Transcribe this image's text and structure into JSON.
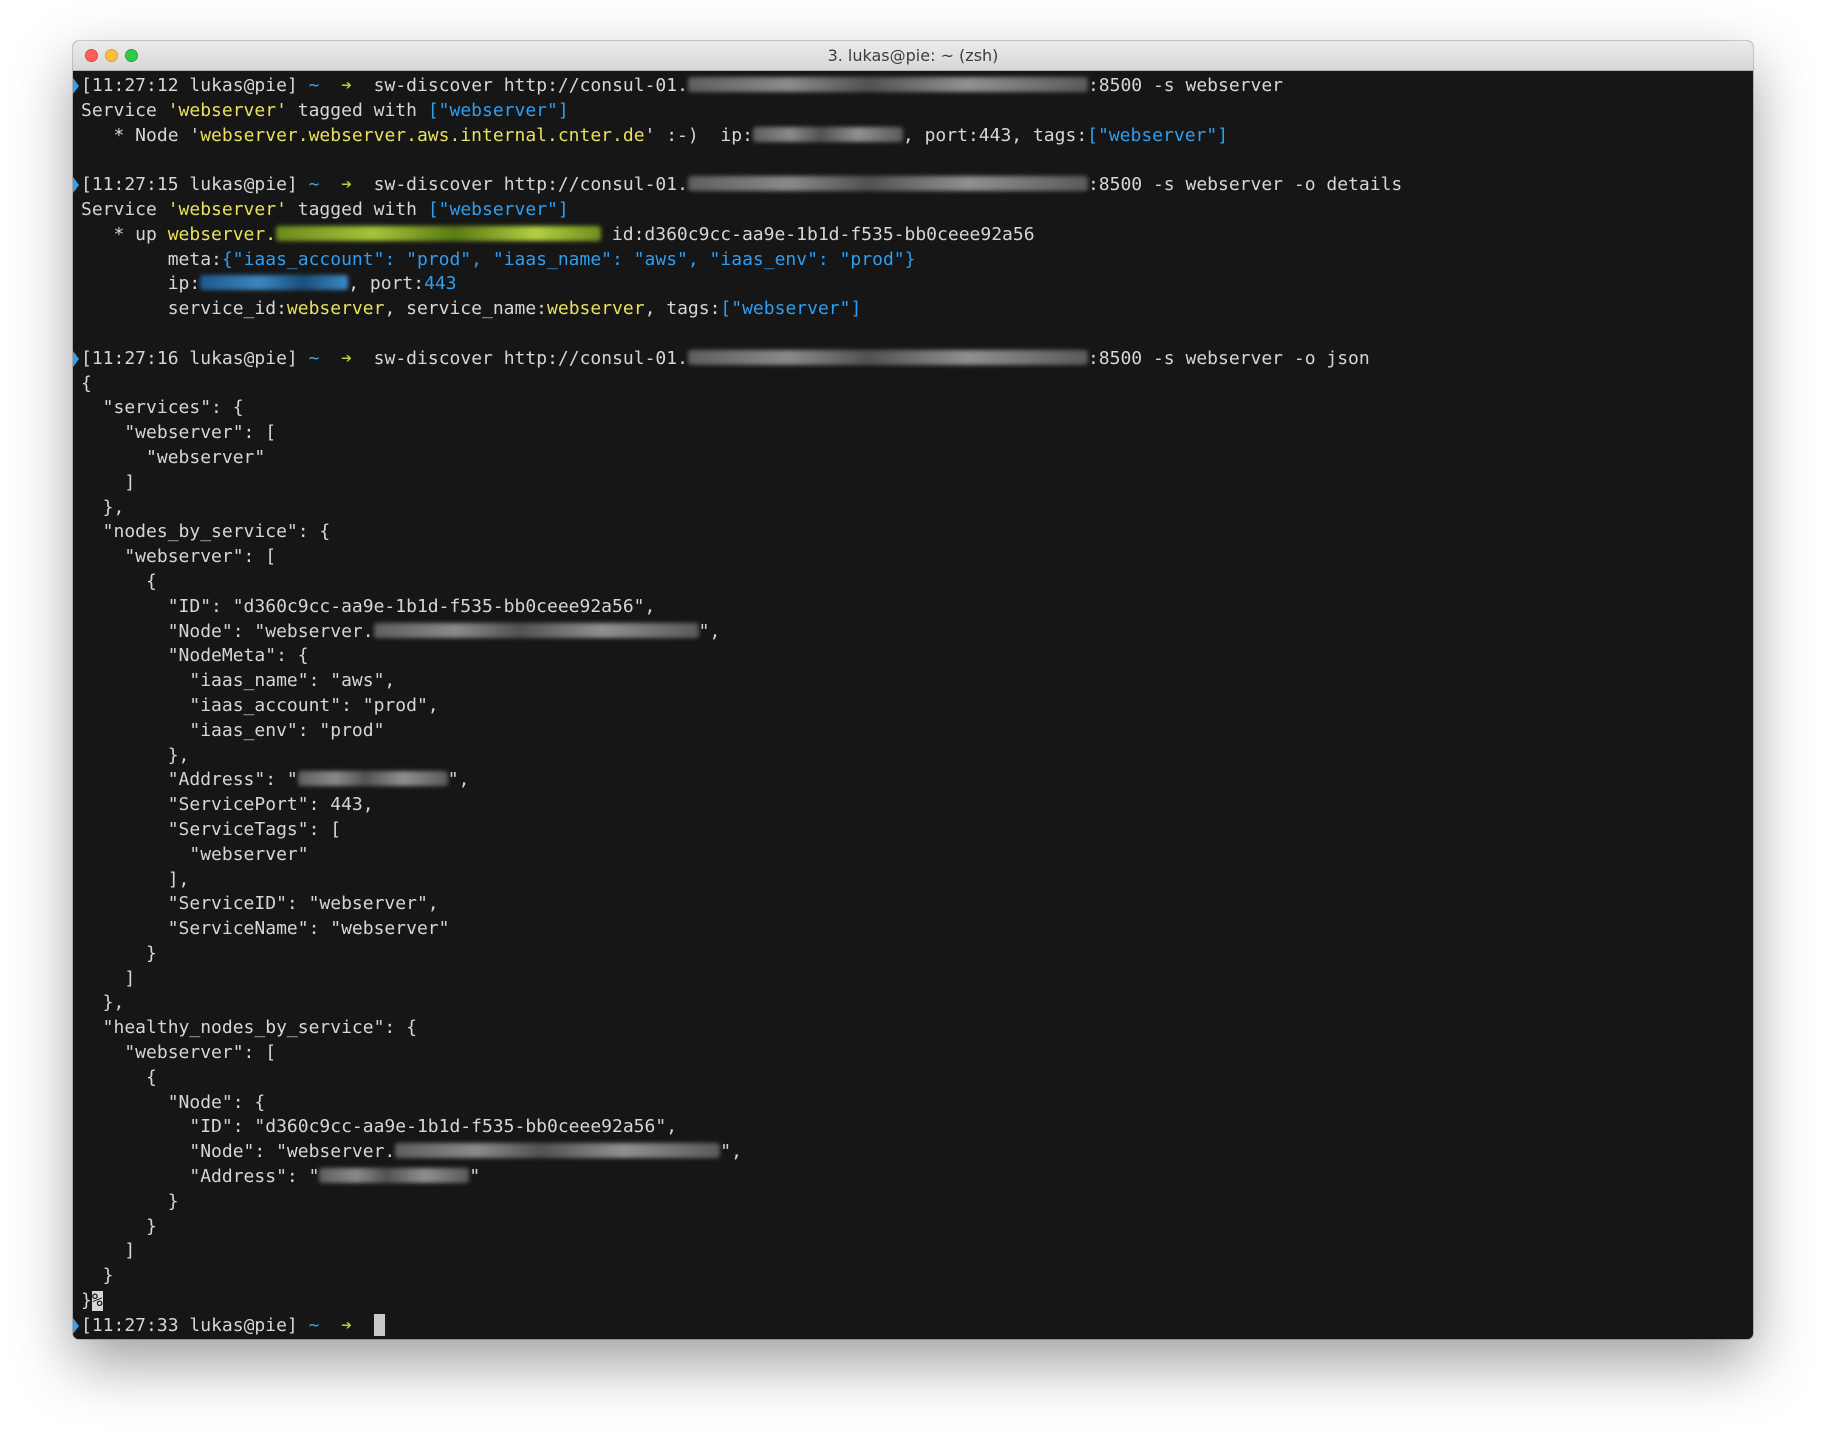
{
  "window": {
    "title": "3. lukas@pie: ~ (zsh)"
  },
  "prompt": {
    "user_host": "lukas@pie]",
    "tilde": "~",
    "arrow": "➔"
  },
  "commands": [
    {
      "time": "[11:27:12",
      "base": "sw-discover http://consul-01.",
      "suffix": ":8500 -s webserver"
    },
    {
      "time": "[11:27:15",
      "base": "sw-discover http://consul-01.",
      "suffix": ":8500 -s webserver -o details"
    },
    {
      "time": "[11:27:16",
      "base": "sw-discover http://consul-01.",
      "suffix": ":8500 -s webserver -o json"
    },
    {
      "time": "[11:27:33"
    }
  ],
  "out1": {
    "service_kw": "Service ",
    "service_name": "'webserver'",
    "tagged": " tagged with ",
    "tags": "[\"webserver\"]",
    "node_prefix": "   * Node '",
    "node_name": "webserver.webserver.aws.internal.cnter.de",
    "node_suffix": "' :-)  ip:",
    "port": ", port:443, tags:",
    "node_tags": "[\"webserver\"]"
  },
  "out2": {
    "up_prefix": "   * up ",
    "host": "webserver.",
    "id": " id:d360c9cc-aa9e-1b1d-f535-bb0ceee92a56",
    "meta_label": "        meta:",
    "meta_value": "{\"iaas_account\": \"prod\", \"iaas_name\": \"aws\", \"iaas_env\": \"prod\"}",
    "ip_label": "        ip:",
    "port_label": ", port:",
    "port_value": "443",
    "sid_label": "        service_id:",
    "sid_value": "webserver",
    "sname_label": ", service_name:",
    "sname_value": "webserver",
    "tags_label": ", tags:",
    "tags_value": "[\"webserver\"]"
  },
  "json_output": [
    "{",
    "  \"services\": {",
    "    \"webserver\": [",
    "      \"webserver\"",
    "    ]",
    "  },",
    "  \"nodes_by_service\": {",
    "    \"webserver\": [",
    "      {",
    "        \"ID\": \"d360c9cc-aa9e-1b1d-f535-bb0ceee92a56\",",
    "        \"Node\": \"webserver.",
    "        \"NodeMeta\": {",
    "          \"iaas_name\": \"aws\",",
    "          \"iaas_account\": \"prod\",",
    "          \"iaas_env\": \"prod\"",
    "        },",
    "        \"Address\": \"",
    "        \"ServicePort\": 443,",
    "        \"ServiceTags\": [",
    "          \"webserver\"",
    "        ],",
    "        \"ServiceID\": \"webserver\",",
    "        \"ServiceName\": \"webserver\"",
    "      }",
    "    ]",
    "  },",
    "  \"healthy_nodes_by_service\": {",
    "    \"webserver\": [",
    "      {",
    "        \"Node\": {",
    "          \"ID\": \"d360c9cc-aa9e-1b1d-f535-bb0ceee92a56\",",
    "          \"Node\": \"webserver.",
    "          \"Address\": \"",
    "        }",
    "      }",
    "    ]",
    "  }",
    "}"
  ],
  "json_tails": {
    "node": "\",",
    "address1": "\",",
    "address2": "\""
  },
  "eof_mark": "%"
}
